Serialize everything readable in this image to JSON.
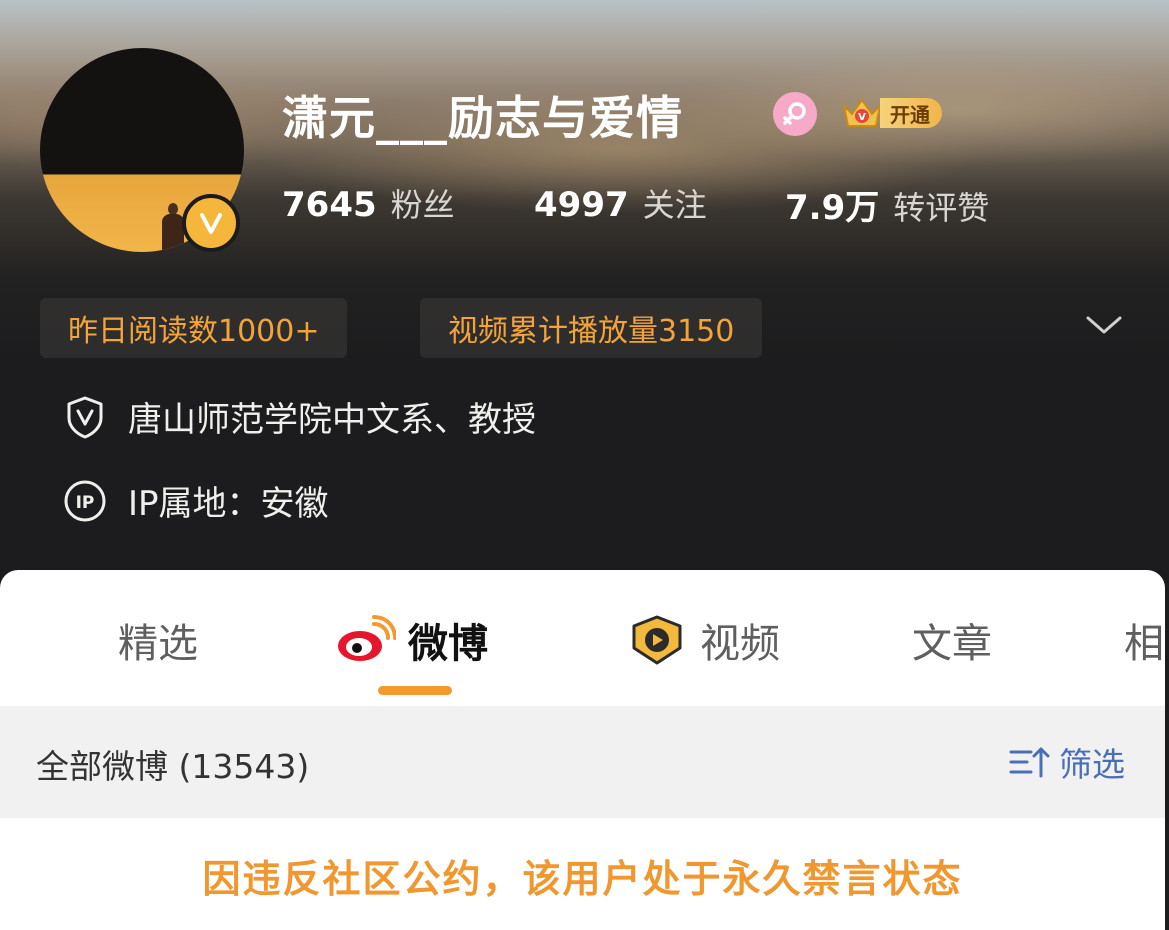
{
  "profile": {
    "username": "潇元___励志与爱情",
    "vip_label": "开通",
    "stats": [
      {
        "value": "7645",
        "label": "粉丝"
      },
      {
        "value": "4997",
        "label": "关注"
      },
      {
        "value": "7.9万",
        "label": "转评赞"
      }
    ],
    "chips": [
      "昨日阅读数1000+",
      "视频累计播放量3150"
    ],
    "verification": "唐山师范学院中文系、教授",
    "ip_location": "IP属地：安徽"
  },
  "tabs": [
    {
      "label": "精选",
      "icon": null,
      "active": false
    },
    {
      "label": "微博",
      "icon": "weibo-icon",
      "active": true
    },
    {
      "label": "视频",
      "icon": "video-play-icon",
      "active": false
    },
    {
      "label": "文章",
      "icon": null,
      "active": false
    },
    {
      "label": "相",
      "icon": null,
      "active": false
    }
  ],
  "feed": {
    "title": "全部微博 (13543)",
    "filter_label": "筛选"
  },
  "notice": "因违反社区公约，该用户处于永久禁言状态",
  "colors": {
    "accent_orange": "#f29a2e",
    "chip_text": "#f2a33a",
    "verified_gold": "#f5b73b",
    "filter_blue": "#4a6fb5"
  }
}
